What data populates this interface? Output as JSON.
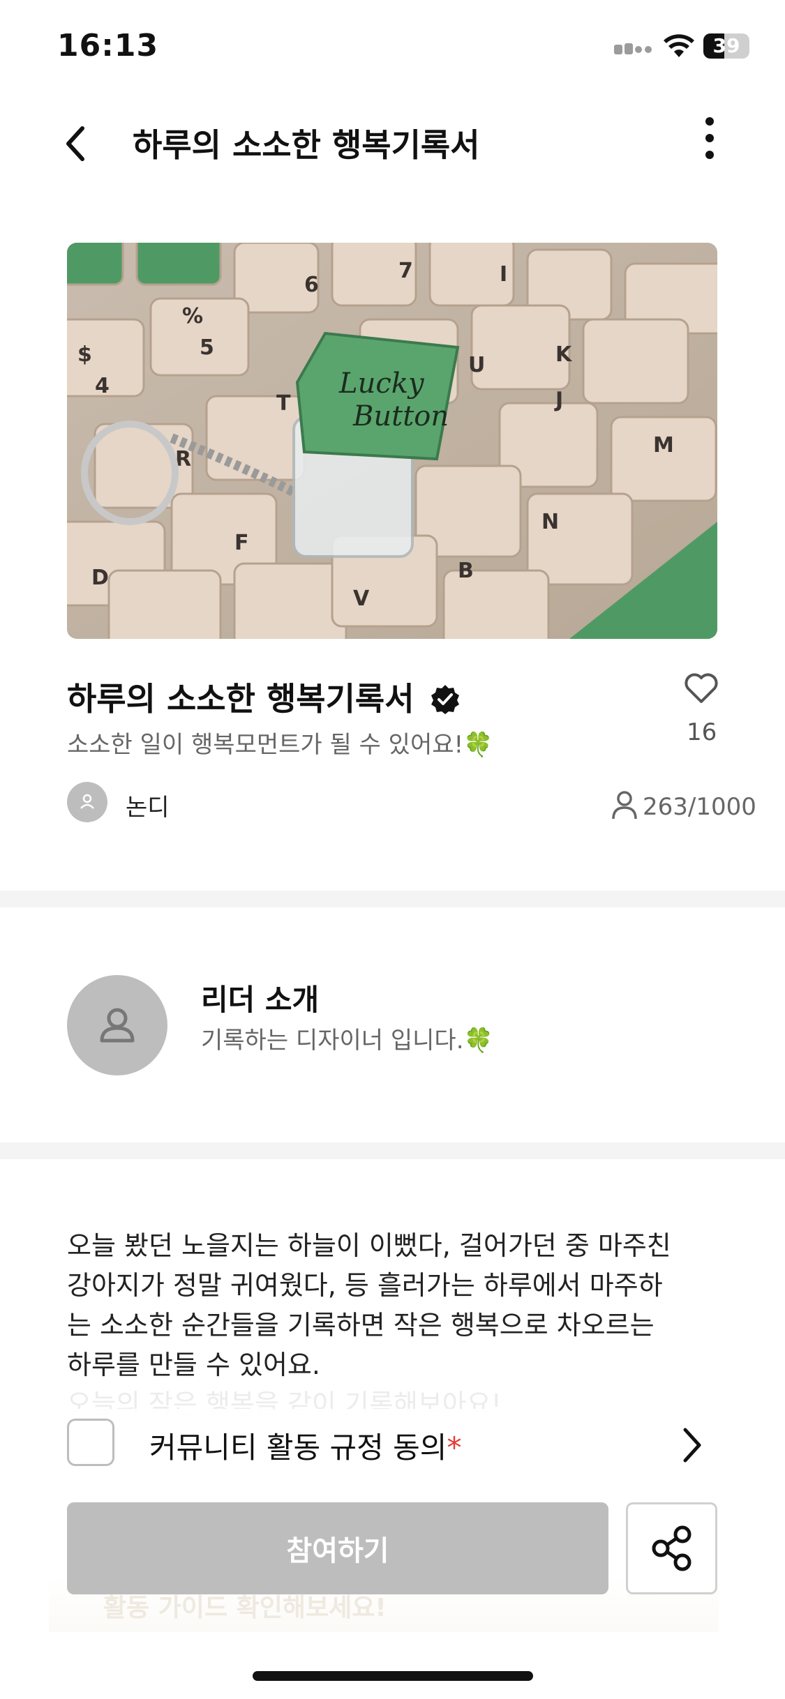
{
  "status_bar": {
    "time": "16:13",
    "battery": "39"
  },
  "nav": {
    "title": "하루의 소소한 행복기록서",
    "back_icon": "chevron-left-icon",
    "more_icon": "more-vertical-icon"
  },
  "club": {
    "title": "하루의 소소한 행복기록서",
    "description": "소소한 일이 행복모먼트가 될 수 있어요!",
    "description_emoji": "🍀",
    "likes": "16",
    "leader_name": "논디",
    "members": "263/1000"
  },
  "leader_intro": {
    "heading": "리더 소개",
    "text": "기록하는 디자이너 입니다.",
    "emoji": "🍀"
  },
  "body_text": {
    "lines": [
      "오늘 봤던 노을지는 하늘이 이뻤다, 걸어가던 중 마주친",
      "강아지가 정말 귀여웠다, 등 흘러가는 하루에서 마주하",
      "는 소소한 순간들을 기록하면 작은 행복으로 차오르는",
      "하루를 만들 수 있어요."
    ],
    "faded_line": "오늘의 작은 행복을 같이 기록해보아요!"
  },
  "agreement": {
    "label": "커뮤니티 활동 규정 동의",
    "required_mark": "*"
  },
  "bottom": {
    "join_label": "참여하기",
    "guide_text": "활동 가이드 확인해보세요!"
  },
  "colors": {
    "accent_green": "#4f9a64",
    "disabled_button": "#bdbdbd",
    "required_red": "#e53935"
  }
}
